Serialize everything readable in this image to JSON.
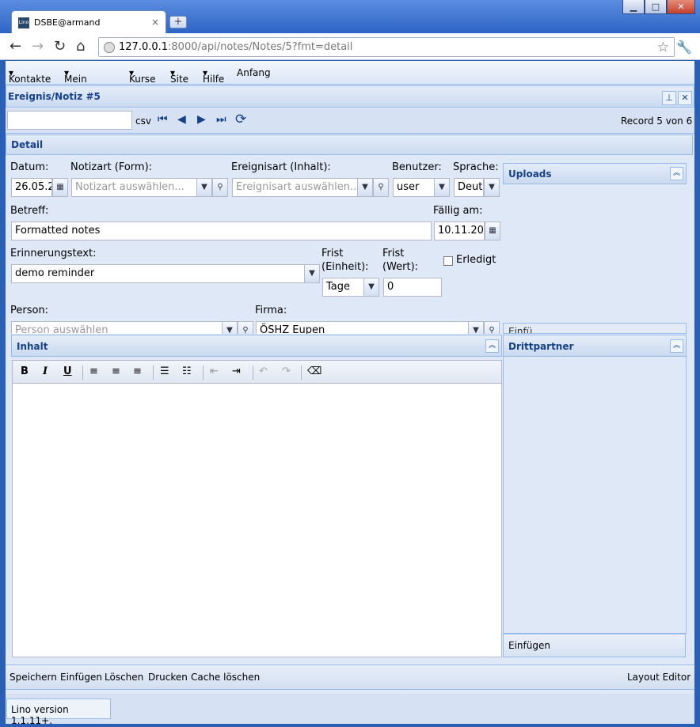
{
  "browser": {
    "tab_title": "DSBE@armand",
    "tab_logo": "Lino",
    "url_host": "127.0.0.1",
    "url_rest": ":8000/api/notes/Notes/5?fmt=detail"
  },
  "menu": [
    "Kontakte",
    "Mein Menü",
    "Kurse",
    "Site",
    "Hilfe",
    "Anfang"
  ],
  "window": {
    "title": "Ereignis/Notiz #5",
    "csv_label": "csv",
    "record_info": "Record 5 von 6"
  },
  "detail": {
    "section_title": "Detail",
    "date_label": "Datum:",
    "date_value": "26.05.2",
    "notiz_label": "Notizart (Form):",
    "notiz_placeholder": "Notizart auswählen...",
    "ereignis_label": "Ereignisart (Inhalt):",
    "ereignis_placeholder": "Ereignisart auswählen...",
    "user_label": "Benutzer:",
    "user_value": "user",
    "lang_label": "Sprache:",
    "lang_value": "Deut",
    "subject_label": "Betreff:",
    "subject_value": "Formatted notes",
    "due_label": "Fällig am:",
    "due_value": "10.11.20",
    "reminder_label": "Erinnerungstext:",
    "reminder_value": "demo reminder",
    "frist_unit_label_1": "Frist",
    "frist_unit_label_2": "(Einheit):",
    "frist_unit_value": "Tage",
    "frist_value_label_1": "Frist",
    "frist_value_label_2": "(Wert):",
    "frist_value": "0",
    "done_label": "Erledigt",
    "person_label": "Person:",
    "person_placeholder": "Person auswählen",
    "firma_label": "Firma:",
    "firma_value": "ÖSHZ Eupen",
    "uploads_title": "Uploads",
    "uploads_insert_partial": "Einfü"
  },
  "content": {
    "title": "Inhalt",
    "third_party_title": "Drittpartner",
    "third_party_insert": "Einfügen"
  },
  "editor_tools": [
    {
      "icon": "bold-icon",
      "glyph": "B"
    },
    {
      "icon": "italic-icon",
      "glyph": "I"
    },
    {
      "icon": "underline-icon",
      "glyph": "U"
    },
    {
      "icon": "align-left-icon",
      "glyph": "≡"
    },
    {
      "icon": "align-center-icon",
      "glyph": "≡"
    },
    {
      "icon": "align-right-icon",
      "glyph": "≡"
    },
    {
      "icon": "bullet-list-icon",
      "glyph": "☰"
    },
    {
      "icon": "numbered-list-icon",
      "glyph": "☷"
    },
    {
      "icon": "outdent-icon",
      "glyph": "⇤"
    },
    {
      "icon": "indent-icon",
      "glyph": "⇥"
    },
    {
      "icon": "undo-icon",
      "glyph": "↶"
    },
    {
      "icon": "redo-icon",
      "glyph": "↷"
    },
    {
      "icon": "eraser-icon",
      "glyph": "⌫"
    }
  ],
  "actions": [
    "Speichern",
    "Einfügen",
    "Löschen",
    "Drucken",
    "Cache löschen"
  ],
  "layout_editor": "Layout Editor",
  "version": "Lino version 1.1.11+."
}
